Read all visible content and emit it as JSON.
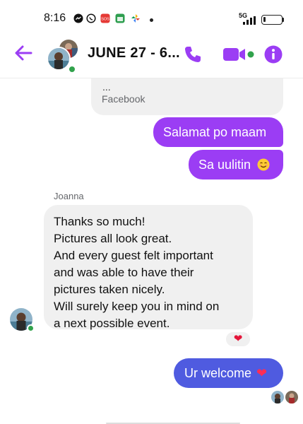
{
  "status_bar": {
    "time": "8:16",
    "network": "5G",
    "battery_level": 0.15
  },
  "header": {
    "title": "JUNE 27 - 6...",
    "icons": [
      "back-arrow-icon",
      "phone-icon",
      "video-camera-icon",
      "info-icon"
    ],
    "accent_color": "#9b3df4",
    "online_color": "#31a24c"
  },
  "conversation": {
    "link_preview": {
      "dots": "...",
      "source": "Facebook"
    },
    "outgoing_1": "Salamat po maam",
    "outgoing_2": "Sa uulitin",
    "outgoing_2_emoji": "smiling-face-emoji",
    "sender_name": "Joanna",
    "incoming_lines": [
      "Thanks so much!",
      "Pictures all look great.",
      "And every guest felt important",
      "and was able to have their",
      "pictures taken nicely.",
      "Will surely keep you in mind on",
      "a next possible event."
    ],
    "reaction": "❤",
    "outgoing_3": "Ur welcome",
    "outgoing_3_emoji": "❤",
    "outgoing_bubble_color": "#9b3df4",
    "last_bubble_color": "#4f5be0"
  }
}
